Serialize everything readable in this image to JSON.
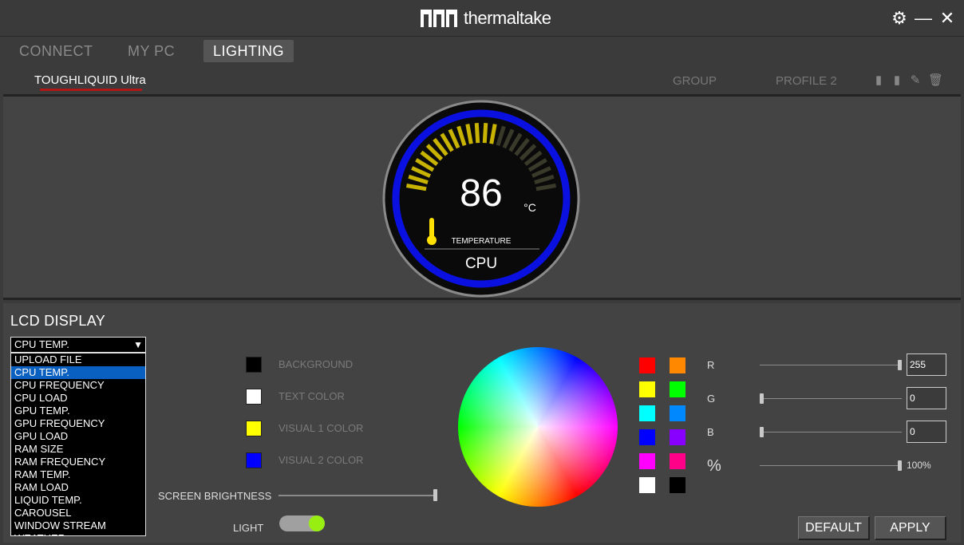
{
  "window": {
    "logo_text": "thermaltake",
    "settings_icon": "gear-icon",
    "minimize_icon": "minimize-icon",
    "close_icon": "close-icon"
  },
  "nav": {
    "tabs": [
      {
        "label": "CONNECT",
        "active": false
      },
      {
        "label": "MY PC",
        "active": false
      },
      {
        "label": "LIGHTING",
        "active": true
      }
    ]
  },
  "subnav": {
    "device": "TOUGHLIQUID Ultra",
    "group": "GROUP",
    "profile": "PROFILE 2",
    "icons": [
      "save-icon",
      "copy-icon",
      "edit-icon",
      "delete-icon"
    ]
  },
  "preview": {
    "value": "86",
    "unit": "°C",
    "caption": "TEMPERATURE",
    "source": "CPU",
    "ring_color": "#0a10e0",
    "gauge_color": "#c8b400"
  },
  "lcd": {
    "title": "LCD DISPLAY",
    "selected": "CPU TEMP.",
    "options": [
      "UPLOAD FILE",
      "CPU TEMP.",
      "CPU FREQUENCY",
      "CPU LOAD",
      "GPU TEMP.",
      "GPU FREQUENCY",
      "GPU LOAD",
      "RAM SIZE",
      "RAM FREQUENCY",
      "RAM TEMP.",
      "RAM LOAD",
      "LIQUID TEMP.",
      "CAROUSEL",
      "WINDOW STREAM",
      "WEATHER"
    ],
    "highlighted_index": 1
  },
  "colors": [
    {
      "label": "BACKGROUND",
      "color": "#000000"
    },
    {
      "label": "TEXT COLOR",
      "color": "#ffffff"
    },
    {
      "label": "VISUAL 1 COLOR",
      "color": "#ffff00"
    },
    {
      "label": "VISUAL 2 COLOR",
      "color": "#0000ff"
    }
  ],
  "brightness": {
    "label": "SCREEN BRIGHTNESS",
    "value": 1.0
  },
  "light": {
    "label": "LIGHT",
    "on": true
  },
  "palette": [
    "#ff0000",
    "#ff8800",
    "#ffff00",
    "#00ff00",
    "#00ffff",
    "#0088ff",
    "#0000ff",
    "#8800ff",
    "#ff00ff",
    "#ff0088",
    "#ffffff",
    "#000000"
  ],
  "rgb": {
    "r": {
      "label": "R",
      "value": "255",
      "level": 1.0
    },
    "g": {
      "label": "G",
      "value": "0",
      "level": 0.0
    },
    "b": {
      "label": "B",
      "value": "0",
      "level": 0.0
    },
    "pct": {
      "label": "%",
      "value": "100%",
      "level": 1.0
    }
  },
  "buttons": {
    "default": "DEFAULT",
    "apply": "APPLY"
  }
}
